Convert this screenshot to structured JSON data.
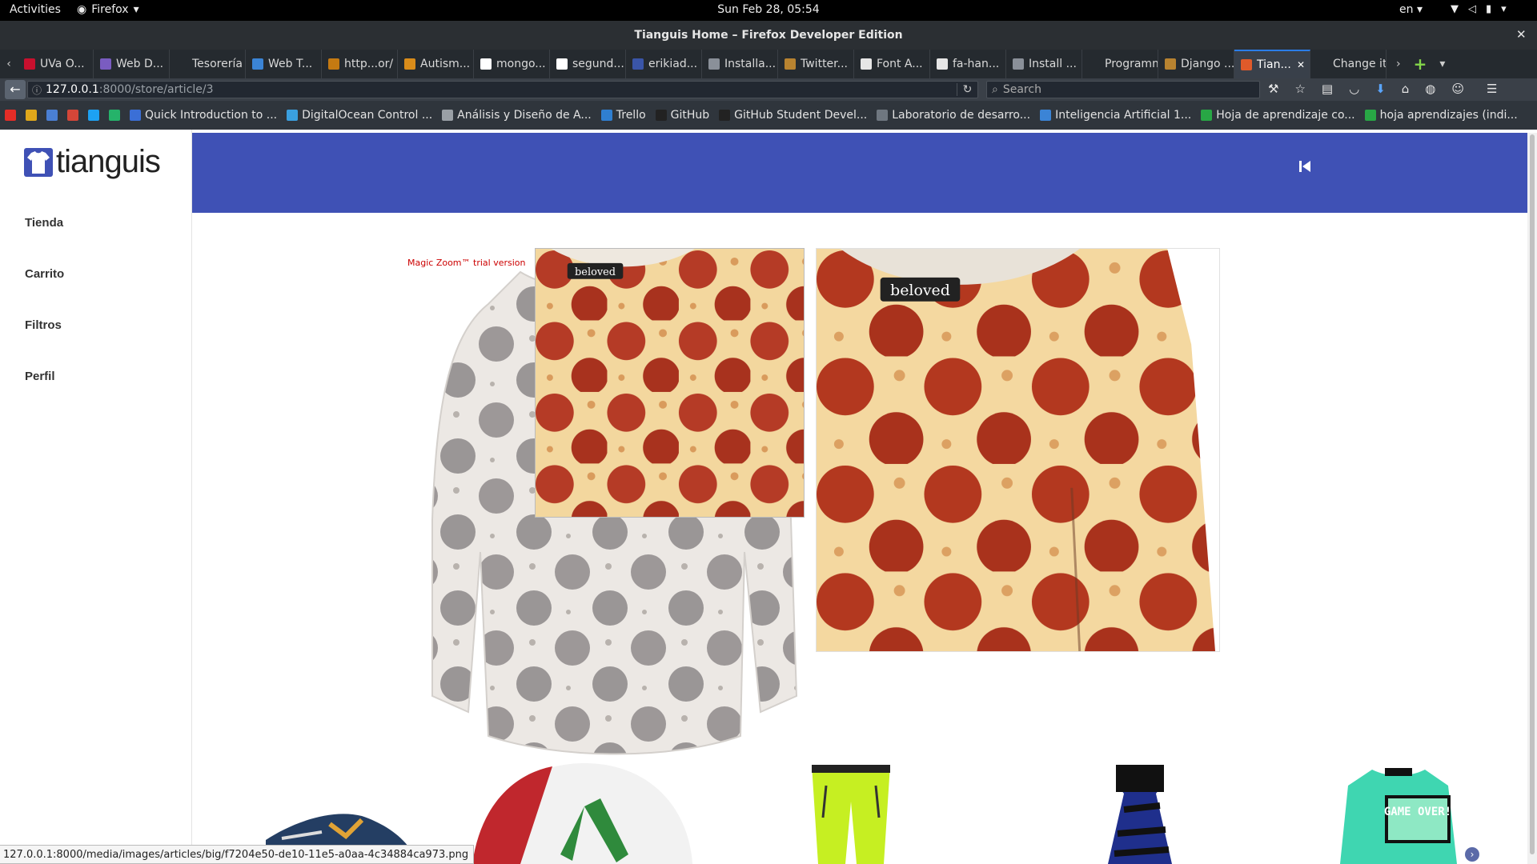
{
  "system": {
    "activities": "Activities",
    "app_name": "Firefox",
    "clock": "Sun Feb 28, 05:54",
    "language": "en"
  },
  "window": {
    "title": "Tianguis Home – Firefox Developer Edition"
  },
  "tabs": [
    {
      "label": "UVa O...",
      "color": "#c8102e"
    },
    {
      "label": "Web D...",
      "color": "#7a5cc1"
    },
    {
      "label": "Tesorería",
      "color": "#252a2f"
    },
    {
      "label": "Web T...",
      "color": "#3b84d6"
    },
    {
      "label": "http...or/",
      "color": "#c57a12"
    },
    {
      "label": "Autism...",
      "color": "#d98c1a"
    },
    {
      "label": "mongo...",
      "color": "#ffffff"
    },
    {
      "label": "segund...",
      "color": "#ffffff"
    },
    {
      "label": "erikiad...",
      "color": "#3a55a8"
    },
    {
      "label": "Installa...",
      "color": "#8a9099"
    },
    {
      "label": "Twitter...",
      "color": "#b88330"
    },
    {
      "label": "Font A...",
      "color": "#e6e6e6"
    },
    {
      "label": "fa-han...",
      "color": "#e6e6e6"
    },
    {
      "label": "Install ...",
      "color": "#8a9099"
    },
    {
      "label": "Programmi...",
      "color": "#252a2f"
    },
    {
      "label": "Django ...",
      "color": "#b88330"
    },
    {
      "label": "Tian...",
      "color": "#e05a2a"
    },
    {
      "label": "Change ite...",
      "color": "#252a2f"
    }
  ],
  "navbar": {
    "url_host": "127.0.0.1",
    "url_path": ":8000/store/article/3",
    "search_placeholder": "Search"
  },
  "bookmarks": [
    {
      "label": "Quick Introduction to ...",
      "color": "#3b6fd6"
    },
    {
      "label": "DigitalOcean Control ...",
      "color": "#3aa0e0"
    },
    {
      "label": "Análisis y Diseño de A...",
      "color": "#9aa0a6"
    },
    {
      "label": "Trello",
      "color": "#2f7fd1"
    },
    {
      "label": "GitHub",
      "color": "#222222"
    },
    {
      "label": "GitHub Student Devel...",
      "color": "#222222"
    },
    {
      "label": "Laboratorio de desarro...",
      "color": "#6f7780"
    },
    {
      "label": "Inteligencia Artificial 1...",
      "color": "#3b84d6"
    },
    {
      "label": "Hoja de aprendizaje co...",
      "color": "#28a745"
    },
    {
      "label": "hoja aprendizajes (indi...",
      "color": "#28a745"
    }
  ],
  "site": {
    "brand": "tianguis",
    "menu": [
      "Tienda",
      "Carrito",
      "Filtros",
      "Perfil"
    ],
    "accent": "#3f51b5",
    "zoom_label": "Magic Zoom™ trial version",
    "product_brand_tag": "beloved",
    "thumb_text": "GAME OVER!"
  },
  "status_bar": {
    "text": "127.0.0.1:8000/media/images/articles/big/f7204e50-de10-11e5-a0aa-4c34884ca973.png"
  }
}
